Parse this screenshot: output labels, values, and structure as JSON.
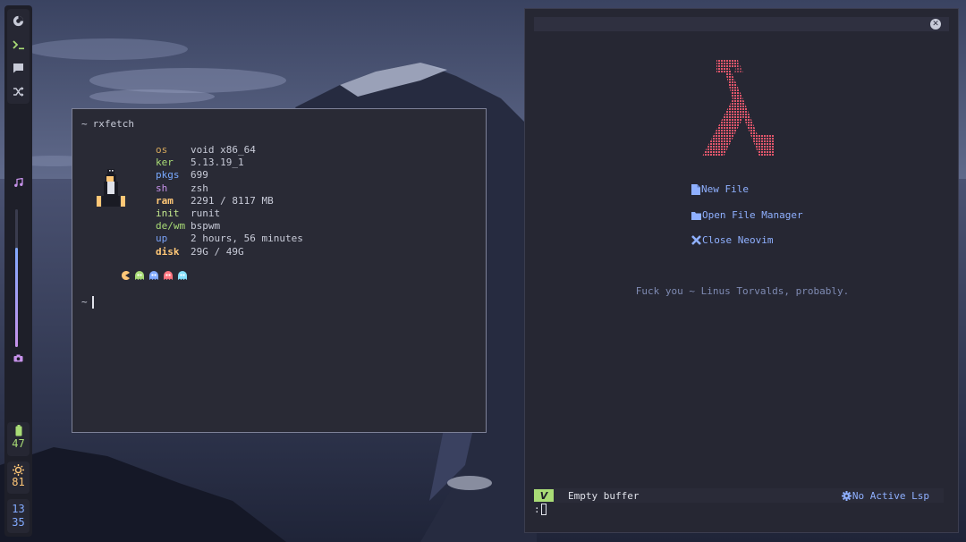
{
  "desktop": {
    "colors": {
      "bar_bg": "#1e1f29",
      "terminal_bg": "#292a35",
      "nvim_bg": "#262733",
      "accent_blue": "#8fb0ff",
      "accent_green": "#a9dc76",
      "accent_pink": "#c792ea",
      "accent_red": "#e0566b"
    }
  },
  "sidebar": {
    "top_icons": [
      "firefox-icon",
      "terminal-icon",
      "chat-icon",
      "shuffle-icon"
    ],
    "music_icon": "music-note-icon",
    "volume_percent": 72,
    "screenshot_icon": "camera-icon",
    "battery": {
      "icon": "battery-icon",
      "value": "47"
    },
    "brightness": {
      "icon": "sun-icon",
      "value": "81"
    },
    "clock": {
      "hour": "13",
      "minute": "35"
    }
  },
  "terminal": {
    "prompt_symbol": "~",
    "command": "rxfetch",
    "info": [
      {
        "key": "os",
        "value": "void x86_64"
      },
      {
        "key": "ker",
        "value": "5.13.19_1"
      },
      {
        "key": "pkgs",
        "value": "699"
      },
      {
        "key": "sh",
        "value": "zsh"
      },
      {
        "key": "ram",
        "value": "2291 / 8117 MB"
      },
      {
        "key": "init",
        "value": "runit"
      },
      {
        "key": "de/wm",
        "value": "bspwm"
      },
      {
        "key": "up",
        "value": "2 hours, 56 minutes"
      },
      {
        "key": "disk",
        "value": "29G / 49G"
      }
    ],
    "pacman_icons": [
      "pacman-icon",
      "ghost-green-icon",
      "ghost-blue-icon",
      "ghost-red-icon",
      "ghost-cyan-icon"
    ],
    "second_prompt": "~"
  },
  "nvim": {
    "logo": "lambda-logo",
    "menu": [
      {
        "icon": "file-icon",
        "label": "New File"
      },
      {
        "icon": "folder-icon",
        "label": "Open File Manager"
      },
      {
        "icon": "close-x-icon",
        "label": "Close Neovim"
      }
    ],
    "quote": "Fuck you ~ Linus Torvalds, probably.",
    "statusline": {
      "mode_icon": "vim-logo-icon",
      "buffer": "Empty buffer",
      "lsp_icon": "gear-icon",
      "lsp": "No Active Lsp"
    },
    "cmdline": ":"
  }
}
